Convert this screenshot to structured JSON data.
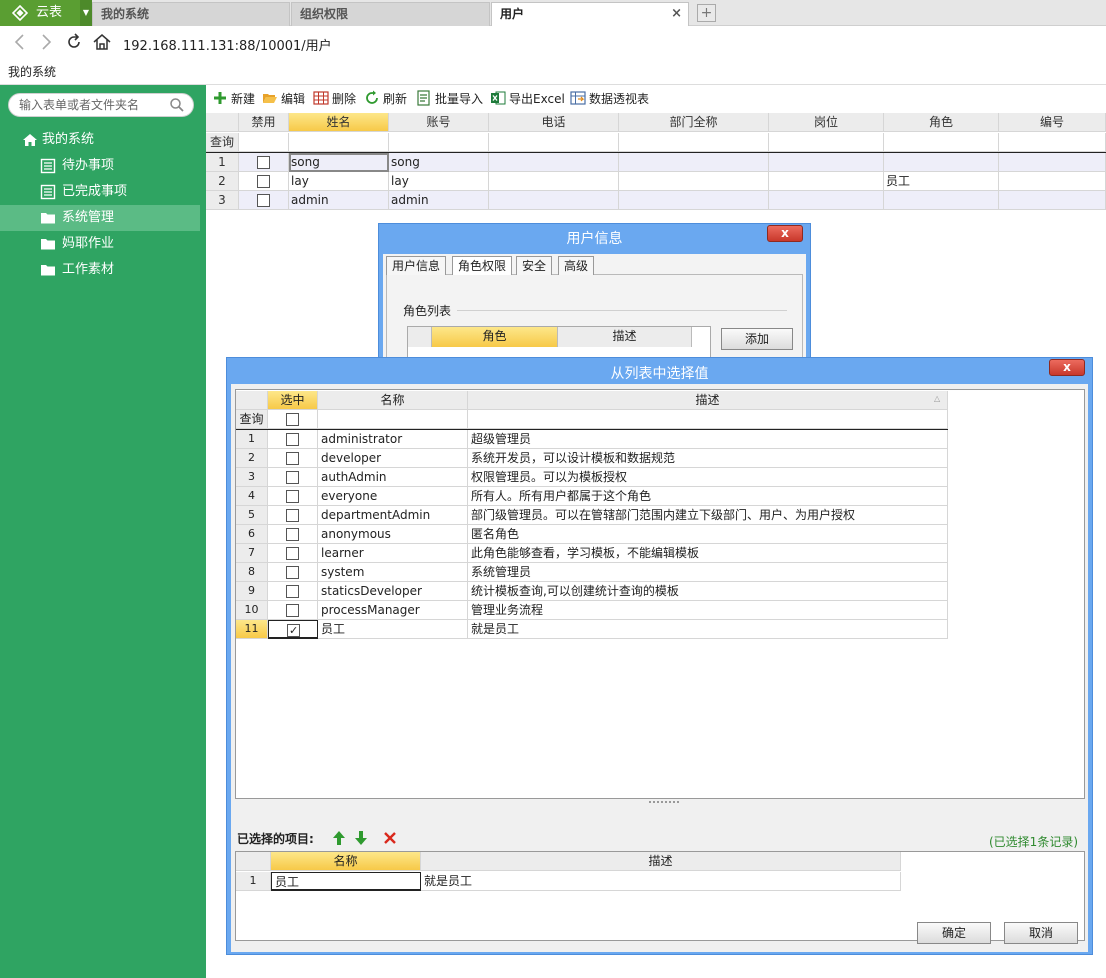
{
  "app": {
    "name": "云表"
  },
  "tabs": [
    {
      "label": "我的系统"
    },
    {
      "label": "组织权限"
    },
    {
      "label": "用户",
      "close": "×"
    }
  ],
  "tab_add": "+",
  "address": {
    "url": "192.168.111.131:88/10001/用户"
  },
  "breadcrumb": "我的系统",
  "sidebar": {
    "search_placeholder": "输入表单或者文件夹名",
    "items": [
      {
        "label": "我的系统",
        "icon": "home-icon"
      },
      {
        "label": "待办事项",
        "icon": "list-icon"
      },
      {
        "label": "已完成事项",
        "icon": "list-icon"
      },
      {
        "label": "系统管理",
        "icon": "folder-icon",
        "selected": true
      },
      {
        "label": "妈耶作业",
        "icon": "folder-icon"
      },
      {
        "label": "工作素材",
        "icon": "folder-icon"
      }
    ]
  },
  "toolbar": {
    "new": "新建",
    "edit": "编辑",
    "delete": "删除",
    "refresh": "刷新",
    "import": "批量导入",
    "export": "导出Excel",
    "pivot": "数据透视表"
  },
  "grid": {
    "query_label": "查询",
    "columns": [
      "禁用",
      "姓名",
      "账号",
      "电话",
      "部门全称",
      "岗位",
      "角色",
      "编号"
    ],
    "rows": [
      {
        "num": "1",
        "name": "song",
        "account": "song",
        "role": ""
      },
      {
        "num": "2",
        "name": "lay",
        "account": "lay",
        "role": "员工"
      },
      {
        "num": "3",
        "name": "admin",
        "account": "admin",
        "role": ""
      }
    ]
  },
  "user_dialog": {
    "title": "用户信息",
    "close": "x",
    "tabs": [
      "用户信息",
      "角色权限",
      "安全",
      "高级"
    ],
    "section": "角色列表",
    "columns": [
      "角色",
      "描述"
    ],
    "add_button": "添加"
  },
  "select_dialog": {
    "title": "从列表中选择值",
    "close": "x",
    "columns": [
      "选中",
      "名称",
      "描述"
    ],
    "query_label": "查询",
    "rows": [
      {
        "num": "1",
        "name": "administrator",
        "desc": "超级管理员",
        "checked": false
      },
      {
        "num": "2",
        "name": "developer",
        "desc": "系统开发员，可以设计模板和数据规范",
        "checked": false
      },
      {
        "num": "3",
        "name": "authAdmin",
        "desc": "权限管理员。可以为模板授权",
        "checked": false
      },
      {
        "num": "4",
        "name": "everyone",
        "desc": "所有人。所有用户都属于这个角色",
        "checked": false
      },
      {
        "num": "5",
        "name": "departmentAdmin",
        "desc": "部门级管理员。可以在管辖部门范围内建立下级部门、用户、为用户授权",
        "checked": false
      },
      {
        "num": "6",
        "name": "anonymous",
        "desc": "匿名角色",
        "checked": false
      },
      {
        "num": "7",
        "name": "learner",
        "desc": "此角色能够查看，学习模板，不能编辑模板",
        "checked": false
      },
      {
        "num": "8",
        "name": "system",
        "desc": "系统管理员",
        "checked": false
      },
      {
        "num": "9",
        "name": "staticsDeveloper",
        "desc": "统计模板查询,可以创建统计查询的模板",
        "checked": false
      },
      {
        "num": "10",
        "name": "processManager",
        "desc": "管理业务流程",
        "checked": false
      },
      {
        "num": "11",
        "name": "员工",
        "desc": "就是员工",
        "checked": true
      }
    ],
    "selected_label": "已选择的项目:",
    "selected_count": "(已选择1条记录)",
    "selected_columns": [
      "名称",
      "描述"
    ],
    "selected_rows": [
      {
        "num": "1",
        "name": "员工",
        "desc": "就是员工"
      }
    ],
    "ok": "确定",
    "cancel": "取消"
  }
}
